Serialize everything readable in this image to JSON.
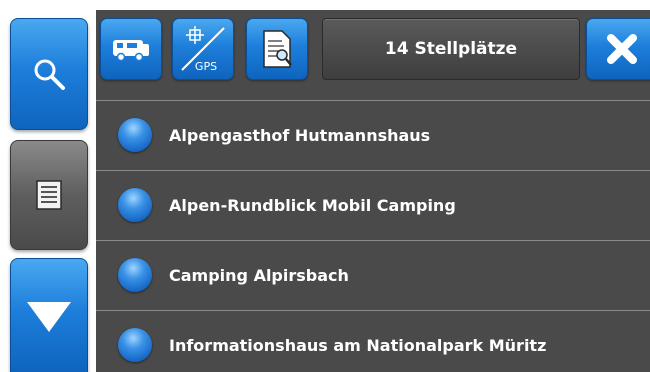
{
  "header": {
    "title": "14 Stellplätze"
  },
  "toolbar": {
    "camper_icon": "camper-icon",
    "gps_icon": "gps-icon",
    "gps_label": "GPS",
    "document_icon": "document-search-icon",
    "close_icon": "close-icon"
  },
  "rail": {
    "search_icon": "search-icon",
    "list_icon": "list-icon",
    "down_icon": "down-arrow-icon"
  },
  "places": [
    {
      "name": "Alpengasthof Hutmannshaus"
    },
    {
      "name": "Alpen-Rundblick Mobil Camping"
    },
    {
      "name": "Camping Alpirsbach"
    },
    {
      "name": "Informationshaus am Nationalpark Müritz"
    }
  ],
  "colors": {
    "accent_blue": "#1d7fdb",
    "panel_gray": "#4a4a4a",
    "divider": "#8a8a8a"
  }
}
